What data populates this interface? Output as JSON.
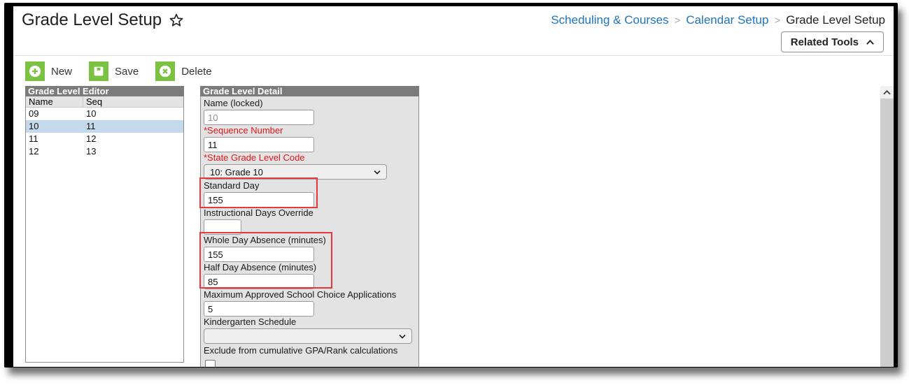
{
  "header": {
    "title": "Grade Level Setup",
    "breadcrumb": [
      {
        "label": "Scheduling & Courses",
        "link": true
      },
      {
        "label": "Calendar Setup",
        "link": true
      },
      {
        "label": "Grade Level Setup",
        "link": false
      }
    ],
    "related_tools_label": "Related Tools"
  },
  "toolbar": {
    "new_label": "New",
    "save_label": "Save",
    "delete_label": "Delete"
  },
  "editor": {
    "title": "Grade Level Editor",
    "columns": [
      "Name",
      "Seq"
    ],
    "rows": [
      {
        "name": "09",
        "seq": "10",
        "selected": false
      },
      {
        "name": "10",
        "seq": "11",
        "selected": true
      },
      {
        "name": "11",
        "seq": "12",
        "selected": false
      },
      {
        "name": "12",
        "seq": "13",
        "selected": false
      }
    ]
  },
  "detail": {
    "title": "Grade Level Detail",
    "name_label": "Name (locked)",
    "name_value": "10",
    "sequence_label": "*Sequence Number",
    "sequence_value": "11",
    "state_code_label": "*State Grade Level Code",
    "state_code_value": "10: Grade 10",
    "standard_day_label": "Standard Day",
    "standard_day_value": "155",
    "instructional_override_label": "Instructional Days Override",
    "instructional_override_value": "",
    "whole_day_label": "Whole Day Absence (minutes)",
    "whole_day_value": "155",
    "half_day_label": "Half Day Absence (minutes)",
    "half_day_value": "85",
    "max_choice_label": "Maximum Approved School Choice Applications",
    "max_choice_value": "5",
    "kinder_label": "Kindergarten Schedule",
    "kinder_value": "",
    "exclude_gpa_label": "Exclude from cumulative GPA/Rank calculations",
    "exclude_gpa_checked": false
  },
  "colors": {
    "accent_green": "#7cc242",
    "link_blue": "#1e74b9",
    "required_red": "#e2161b",
    "highlight_red": "#e8383d",
    "selected_row": "#c5d9ec"
  }
}
